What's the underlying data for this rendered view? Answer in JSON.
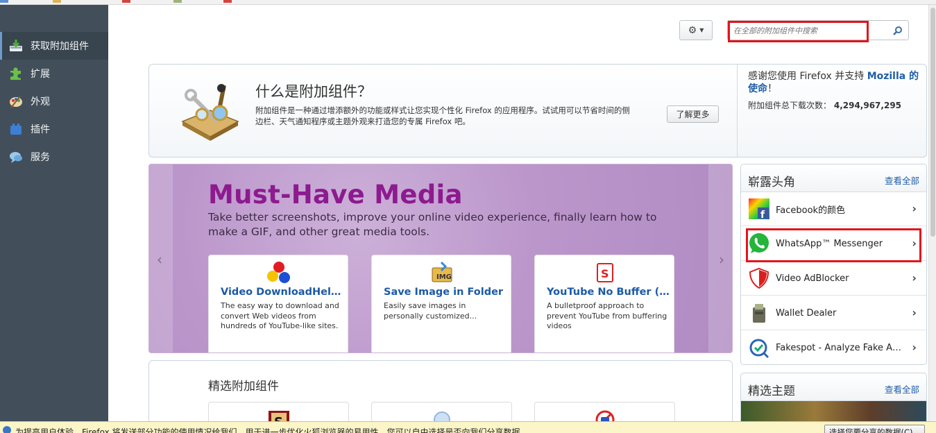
{
  "sidebar": {
    "items": [
      {
        "label": "获取附加组件",
        "icon": "get-addons-icon",
        "active": true
      },
      {
        "label": "扩展",
        "icon": "puzzle-icon"
      },
      {
        "label": "外观",
        "icon": "palette-icon"
      },
      {
        "label": "插件",
        "icon": "plugin-block-icon"
      },
      {
        "label": "服务",
        "icon": "speech-bubble-icon"
      }
    ]
  },
  "toolbar": {
    "gear_icon": "gear-icon",
    "search_placeholder": "在全部的附加组件中搜索",
    "search_icon": "search-icon"
  },
  "info": {
    "title": "什么是附加组件？",
    "description": "附加组件是一种通过增添额外的功能或样式让您实现个性化 Firefox 的应用程序。试试用可以节省时间的侧边栏、天气通知程序或主题外观来打造您的专属 Firefox 吧。",
    "learn_more": "了解更多",
    "thanks_prefix": "感谢您使用 Firefox 并支持 ",
    "thanks_link": "Mozilla 的使命",
    "thanks_suffix": "！",
    "downloads_label": "附加组件总下载次数：",
    "downloads_value": "4,294,967,295"
  },
  "promo": {
    "title": "Must-Have Media",
    "subtitle": "Take better screenshots, improve your online video experience, finally learn how to make a GIF, and other great media tools.",
    "cards": [
      {
        "title": "Video DownloadHelper",
        "desc": "The easy way to download and convert Web videos from hundreds of YouTube-like sites."
      },
      {
        "title": "Save Image in Folder",
        "desc": "Easily save images in personally customized..."
      },
      {
        "title": "YouTube No Buffer (…",
        "desc": "A bulletproof approach to prevent YouTube from buffering videos"
      }
    ]
  },
  "featured": {
    "title": "精选附加组件"
  },
  "upandcoming": {
    "title": "崭露头角",
    "view_all": "查看全部",
    "items": [
      {
        "name": "Facebook的颜色"
      },
      {
        "name": "WhatsApp™ Messenger"
      },
      {
        "name": "Video AdBlocker"
      },
      {
        "name": "Wallet Dealer"
      },
      {
        "name": "Fakespot - Analyze Fake A…"
      }
    ]
  },
  "themes": {
    "title": "精选主题",
    "view_all": "查看全部"
  },
  "notification": {
    "text": "为提高用户体验，Firefox 将发送部分功能的使用情况给我们，用于进一步优化火狐浏览器的易用性，您可以自由选择是否向我们分享数据。",
    "button": "选择您要分享的数据(C)"
  },
  "colors": {
    "sidebar_bg": "#424f5a",
    "accent_link": "#1e5ea8",
    "promo_title": "#8d1a8f",
    "highlight_red": "#e3141b"
  }
}
